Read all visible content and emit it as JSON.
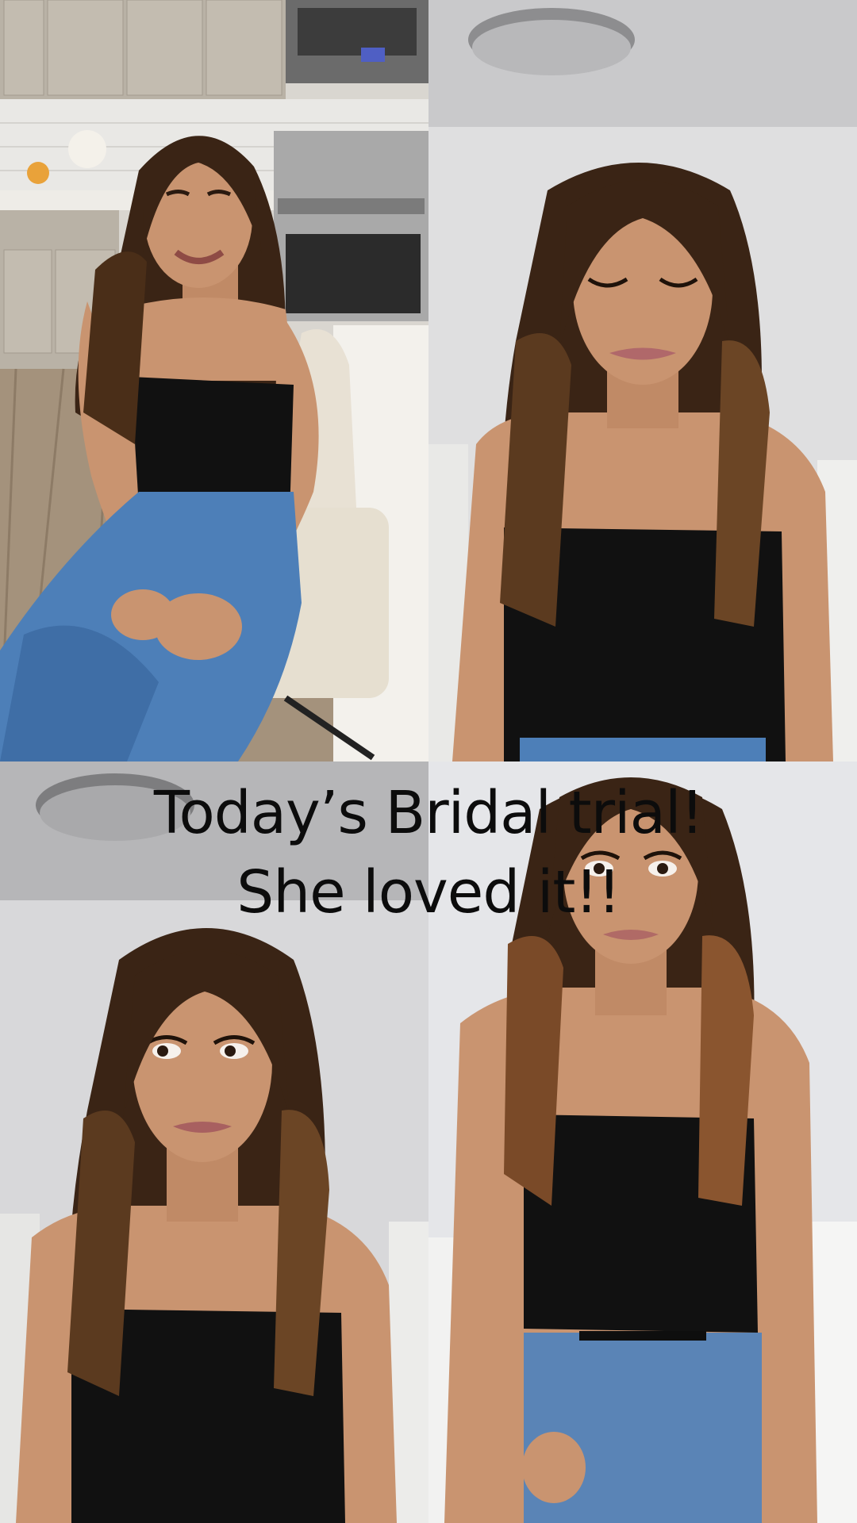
{
  "caption": {
    "line1": "Today’s Bridal trial!",
    "line2": "She loved it!!"
  },
  "panels": [
    {
      "name": "before-photo",
      "scene": "kitchen"
    },
    {
      "name": "after-photo-eyes-closed",
      "scene": "living-room"
    },
    {
      "name": "after-photo-looking-side",
      "scene": "living-room"
    },
    {
      "name": "after-photo-front",
      "scene": "white-backdrop"
    }
  ],
  "colors": {
    "caption_text": "#0c0c0c",
    "top_wear": "#111111",
    "jeans": "#4d7fb8",
    "hair": "#3a2415",
    "skin": "#c99470"
  }
}
